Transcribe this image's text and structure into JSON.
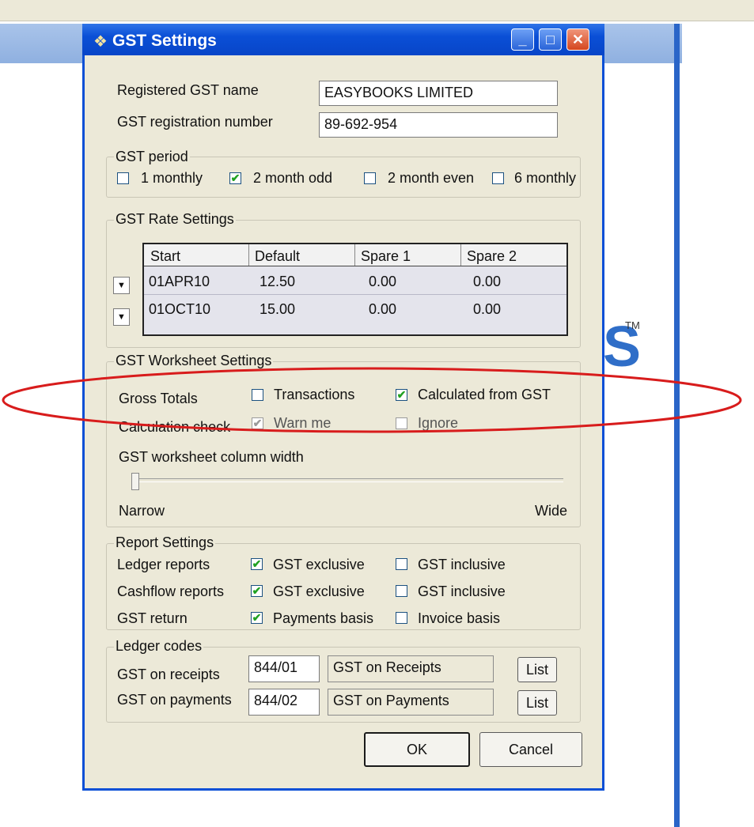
{
  "window": {
    "title": "GST Settings",
    "minimize": "_",
    "maximize": "□",
    "close": "✕"
  },
  "registration": {
    "name_label": "Registered GST name",
    "name_value": "EASYBOOKS LIMITED",
    "number_label": "GST registration number",
    "number_value": "89-692-954"
  },
  "gst_period": {
    "legend": "GST period",
    "options": [
      {
        "label": "1 monthly",
        "checked": false
      },
      {
        "label": "2 month odd",
        "checked": true
      },
      {
        "label": "2 month even",
        "checked": false
      },
      {
        "label": "6 monthly",
        "checked": false
      }
    ]
  },
  "rate_settings": {
    "legend": "GST Rate Settings",
    "columns": [
      "Start",
      "Default",
      "Spare 1",
      "Spare 2"
    ],
    "rows": [
      [
        "01APR10",
        "12.50",
        "0.00",
        "0.00"
      ],
      [
        "01OCT10",
        "15.00",
        "0.00",
        "0.00"
      ]
    ]
  },
  "worksheet": {
    "legend": "GST Worksheet Settings",
    "gross_totals_label": "Gross Totals",
    "transactions_label": "Transactions",
    "transactions_checked": false,
    "calculated_label": "Calculated from GST",
    "calculated_checked": true,
    "calc_check_label": "Calculation check",
    "warn_label": "Warn me",
    "warn_checked": true,
    "ignore_label": "Ignore",
    "ignore_checked": false,
    "column_width_label": "GST worksheet column width",
    "narrow_label": "Narrow",
    "wide_label": "Wide",
    "column_width_level": 0.0
  },
  "report_settings": {
    "legend": "Report Settings",
    "rows": [
      {
        "label": "Ledger reports",
        "opt1": "GST exclusive",
        "opt1_checked": true,
        "opt2": "GST inclusive",
        "opt2_checked": false
      },
      {
        "label": "Cashflow reports",
        "opt1": "GST exclusive",
        "opt1_checked": true,
        "opt2": "GST inclusive",
        "opt2_checked": false
      },
      {
        "label": "GST return",
        "opt1": "Payments basis",
        "opt1_checked": true,
        "opt2": "Invoice basis",
        "opt2_checked": false
      }
    ]
  },
  "ledger_codes": {
    "legend": "Ledger codes",
    "rows": [
      {
        "label": "GST on receipts",
        "code": "844/01",
        "description": "GST on Receipts",
        "button": "List"
      },
      {
        "label": "GST on payments",
        "code": "844/02",
        "description": "GST on Payments",
        "button": "List"
      }
    ]
  },
  "buttons": {
    "ok": "OK",
    "cancel": "Cancel"
  },
  "background": {
    "logo_fragment": "S",
    "trademark": "TM"
  },
  "colors": {
    "title_bar": "#0a4fd6",
    "dialog_bg": "#ece9d8",
    "annotation": "#d81c1c",
    "check_mark": "#21a121"
  }
}
